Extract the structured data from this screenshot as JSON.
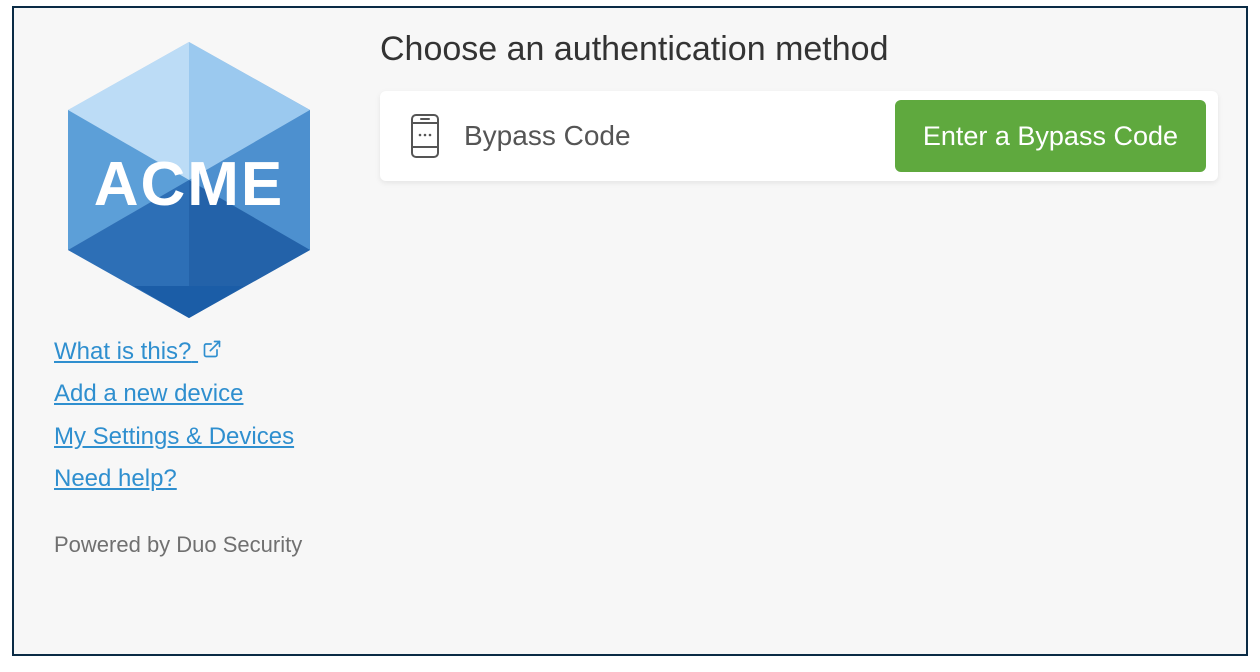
{
  "logo": {
    "brand_text": "ACME"
  },
  "sidebar": {
    "links": {
      "what": "What is this?",
      "add": "Add a new device",
      "settings": "My Settings & Devices",
      "help": "Need help?"
    },
    "powered": "Powered by Duo Security"
  },
  "main": {
    "heading": "Choose an authentication method",
    "method": {
      "label": "Bypass Code",
      "button": "Enter a Bypass Code"
    }
  }
}
